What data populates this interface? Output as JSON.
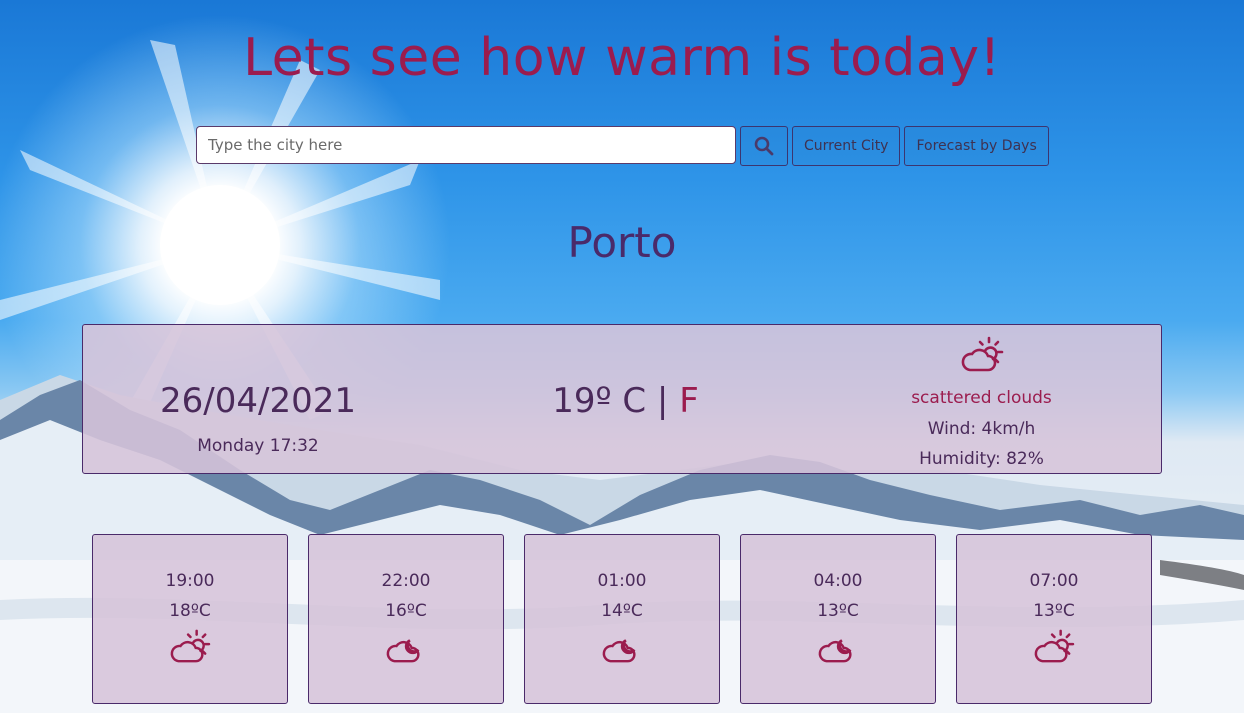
{
  "header": {
    "title": "Lets see how warm is today!"
  },
  "search": {
    "placeholder": "Type the city here",
    "value": "",
    "search_icon": "search-icon",
    "current_city_label": "Current City",
    "forecast_label": "Forecast by Days"
  },
  "city": {
    "name": "Porto"
  },
  "current": {
    "date": "26/04/2021",
    "day_time": "Monday 17:32",
    "temperature": "19º",
    "unit_c": "C",
    "separator": "|",
    "unit_f": "F",
    "icon": "partly-sunny-icon",
    "description": "scattered clouds",
    "wind": "Wind: 4km/h",
    "humidity": "Humidity: 82%"
  },
  "forecast": [
    {
      "time": "19:00",
      "temp": "18ºC",
      "icon": "partly-sunny-icon"
    },
    {
      "time": "22:00",
      "temp": "16ºC",
      "icon": "cloud-moon-icon"
    },
    {
      "time": "01:00",
      "temp": "14ºC",
      "icon": "cloud-moon-icon"
    },
    {
      "time": "04:00",
      "temp": "13ºC",
      "icon": "cloud-moon-icon"
    },
    {
      "time": "07:00",
      "temp": "13ºC",
      "icon": "partly-sunny-icon"
    }
  ],
  "colors": {
    "accent": "#9b1c4e",
    "text": "#4a2a5a",
    "card_bg": "#d6c4da",
    "sky": "#2e94e8"
  }
}
